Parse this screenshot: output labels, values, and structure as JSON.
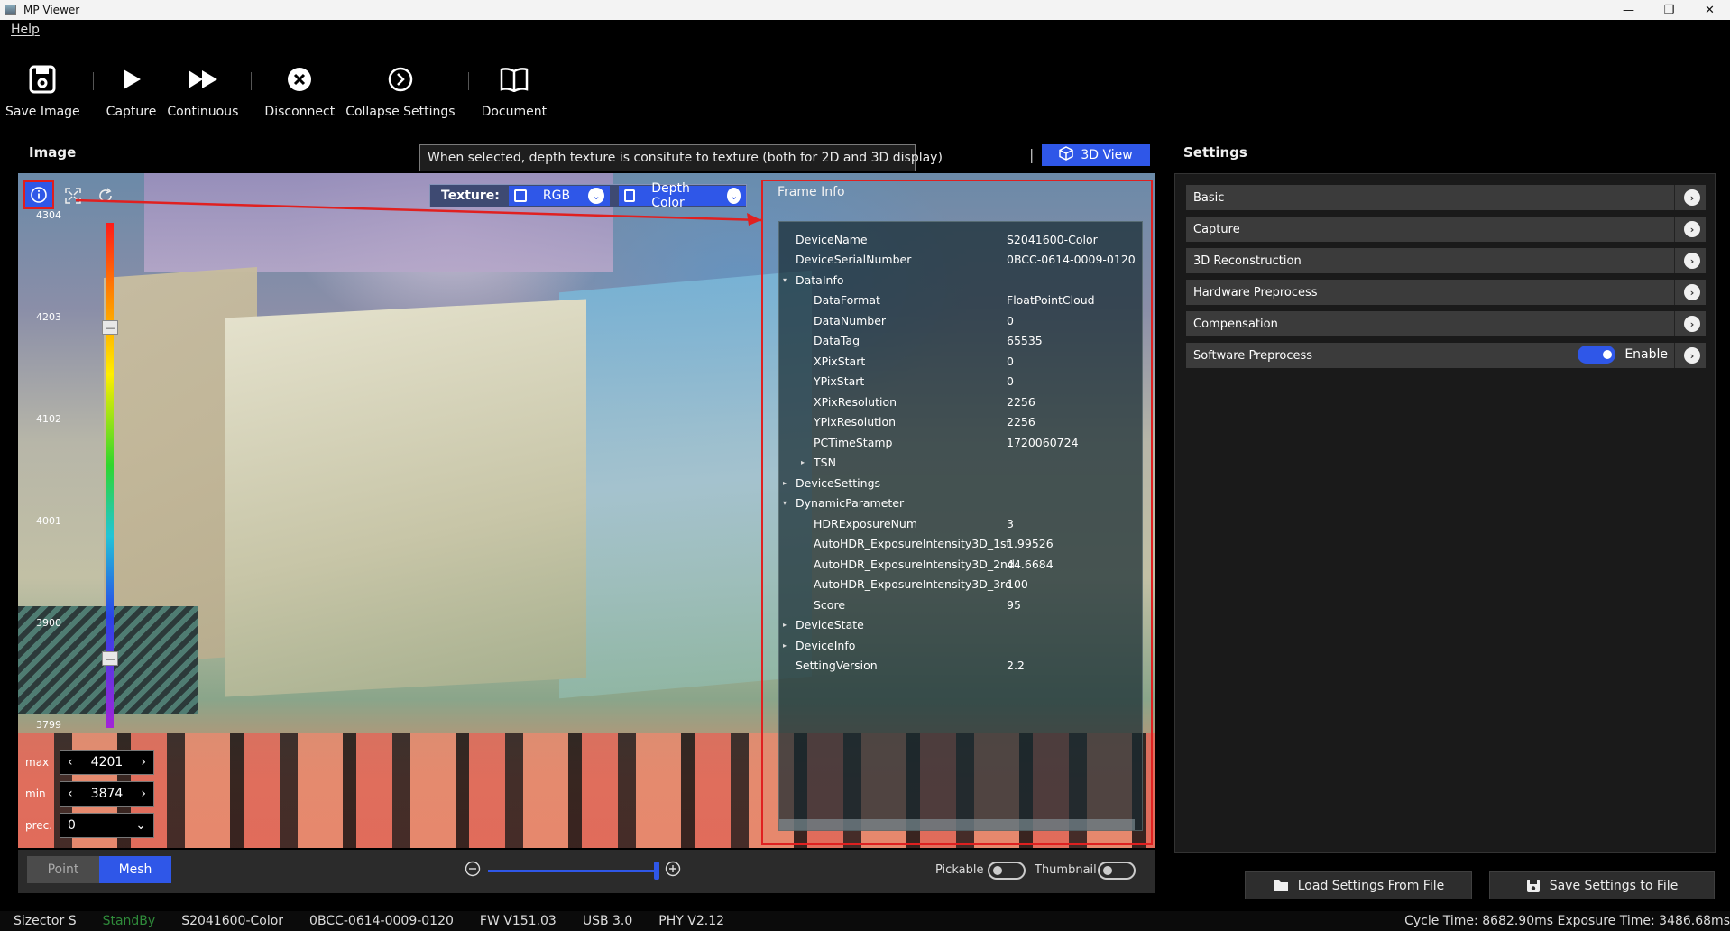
{
  "window": {
    "title": "MP Viewer",
    "minimize": "—",
    "maximize": "❐",
    "close": "✕"
  },
  "menu": {
    "help": "Help"
  },
  "toolbar": {
    "save_image": "Save Image",
    "capture": "Capture",
    "continuous": "Continuous",
    "disconnect": "Disconnect",
    "collapse_settings": "Collapse Settings",
    "document": "Document"
  },
  "image_panel": {
    "title": "Image",
    "tooltip": "When selected, depth texture is consitute to texture (both for 2D and 3D display)",
    "pipe": "|",
    "view_3d": "3D View",
    "texture": {
      "label": "Texture:",
      "rgb": "RGB",
      "depth_color": "Depth Color"
    },
    "colorbar_ticks": [
      "4304",
      "4203",
      "4102",
      "4001",
      "3900",
      "3799"
    ],
    "range": {
      "max_label": "max",
      "max_value": "4201",
      "min_label": "min",
      "min_value": "3874",
      "prec_label": "prec.",
      "prec_value": "0"
    },
    "mode": {
      "point": "Point",
      "mesh": "Mesh"
    },
    "pickable": "Pickable",
    "thumbnail": "Thumbnail"
  },
  "frame_info": {
    "title": "Frame Info",
    "rows": [
      {
        "key": "DeviceName",
        "value": "S2041600-Color",
        "level": 0,
        "arrow": ""
      },
      {
        "key": "DeviceSerialNumber",
        "value": "0BCC-0614-0009-0120",
        "level": 0,
        "arrow": ""
      },
      {
        "key": "DataInfo",
        "value": "",
        "level": 0,
        "arrow": "▾"
      },
      {
        "key": "DataFormat",
        "value": "FloatPointCloud",
        "level": 1,
        "arrow": ""
      },
      {
        "key": "DataNumber",
        "value": "0",
        "level": 1,
        "arrow": ""
      },
      {
        "key": "DataTag",
        "value": "65535",
        "level": 1,
        "arrow": ""
      },
      {
        "key": "XPixStart",
        "value": "0",
        "level": 1,
        "arrow": ""
      },
      {
        "key": "YPixStart",
        "value": "0",
        "level": 1,
        "arrow": ""
      },
      {
        "key": "XPixResolution",
        "value": "2256",
        "level": 1,
        "arrow": ""
      },
      {
        "key": "YPixResolution",
        "value": "2256",
        "level": 1,
        "arrow": ""
      },
      {
        "key": "PCTimeStamp",
        "value": "1720060724",
        "level": 1,
        "arrow": ""
      },
      {
        "key": "TSN",
        "value": "",
        "level": 1,
        "arrow": "▸"
      },
      {
        "key": "DeviceSettings",
        "value": "",
        "level": 0,
        "arrow": "▸"
      },
      {
        "key": "DynamicParameter",
        "value": "",
        "level": 0,
        "arrow": "▾"
      },
      {
        "key": "HDRExposureNum",
        "value": "3",
        "level": 1,
        "arrow": ""
      },
      {
        "key": "AutoHDR_ExposureIntensity3D_1st",
        "value": "1.99526",
        "level": 1,
        "arrow": ""
      },
      {
        "key": "AutoHDR_ExposureIntensity3D_2nd",
        "value": "44.6684",
        "level": 1,
        "arrow": ""
      },
      {
        "key": "AutoHDR_ExposureIntensity3D_3rd",
        "value": "100",
        "level": 1,
        "arrow": ""
      },
      {
        "key": "Score",
        "value": "95",
        "level": 1,
        "arrow": ""
      },
      {
        "key": "DeviceState",
        "value": "",
        "level": 0,
        "arrow": "▸"
      },
      {
        "key": "DeviceInfo",
        "value": "",
        "level": 0,
        "arrow": "▸"
      },
      {
        "key": "SettingVersion",
        "value": "2.2",
        "level": 0,
        "arrow": ""
      }
    ]
  },
  "settings": {
    "title": "Settings",
    "sections": [
      {
        "label": "Basic"
      },
      {
        "label": "Capture"
      },
      {
        "label": "3D Reconstruction"
      },
      {
        "label": "Hardware Preprocess"
      },
      {
        "label": "Compensation"
      },
      {
        "label": "Software Preprocess",
        "toggle_label": "Enable"
      }
    ],
    "load_button": "Load Settings From File",
    "save_button": "Save Settings to File"
  },
  "status": {
    "model": "Sizector S",
    "state": "StandBy",
    "device": "S2041600-Color",
    "serial": "0BCC-0614-0009-0120",
    "fw": "FW V151.03",
    "usb": "USB 3.0",
    "phy": "PHY V2.12",
    "timing": "Cycle Time: 8682.90ms Exposure Time: 3486.68ms"
  },
  "colors": {
    "accent": "#2f57e8",
    "highlight": "#e02020",
    "standby": "#2f8a3a"
  }
}
